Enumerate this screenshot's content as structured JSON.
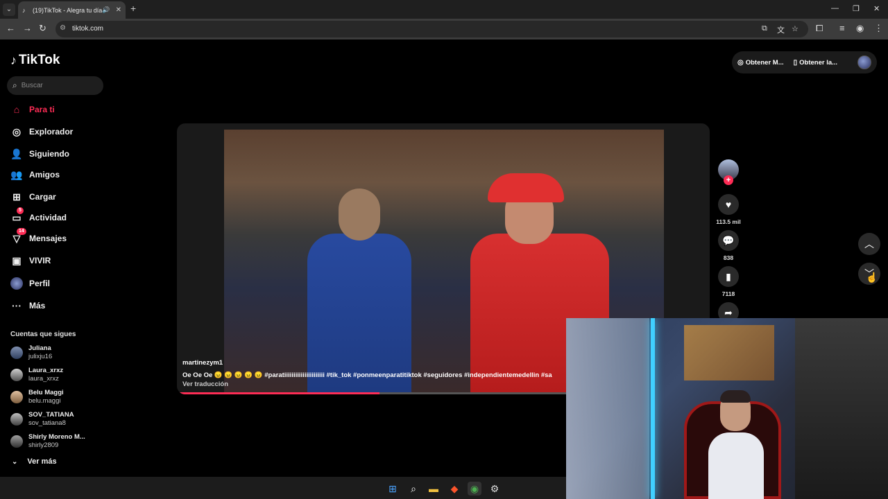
{
  "browser": {
    "tab_title": "(19)TikTok - Alegra tu día",
    "url": "tiktok.com"
  },
  "app": {
    "name": "TikTok",
    "search_placeholder": "Buscar"
  },
  "sidebar": {
    "items": [
      {
        "label": "Para ti",
        "icon": "home-icon",
        "active": true
      },
      {
        "label": "Explorador",
        "icon": "compass-icon"
      },
      {
        "label": "Siguiendo",
        "icon": "following-icon"
      },
      {
        "label": "Amigos",
        "icon": "friends-icon"
      },
      {
        "label": "Cargar",
        "icon": "upload-icon"
      },
      {
        "label": "Actividad",
        "icon": "activity-icon",
        "badge": "5"
      },
      {
        "label": "Mensajes",
        "icon": "messages-icon",
        "badge": "14"
      },
      {
        "label": "VIVIR",
        "icon": "live-icon"
      },
      {
        "label": "Perfil",
        "icon": "profile-icon"
      },
      {
        "label": "Más",
        "icon": "more-icon"
      }
    ],
    "following_title": "Cuentas que sigues",
    "accounts": [
      {
        "name": "Juliana",
        "user": "julixju16"
      },
      {
        "name": "Laura_xrxz",
        "user": "laura_xrxz"
      },
      {
        "name": "Belu Maggi",
        "user": "belu.maggi"
      },
      {
        "name": "SOV_TATIANA",
        "user": "sov_tatiana8"
      },
      {
        "name": "Shirly Moreno M...",
        "user": "shirly2809"
      }
    ],
    "see_more": "Ver más"
  },
  "topbar": {
    "get_coins": "Obtener M...",
    "get_app": "Obtener la..."
  },
  "video": {
    "author": "martinezym1",
    "description": "Oe Oe Oe 😠 😠 😠 😠 😠 #paratiiiiiiiiiiiiiiiiiiiiii #tik_tok #ponmeenparatitiktok #seguidores #independientemedellin #sa",
    "translate": "Ver traducción",
    "progress": 0.38
  },
  "actions": {
    "likes": "113.5 mil",
    "comments": "838",
    "saves": "7118"
  }
}
